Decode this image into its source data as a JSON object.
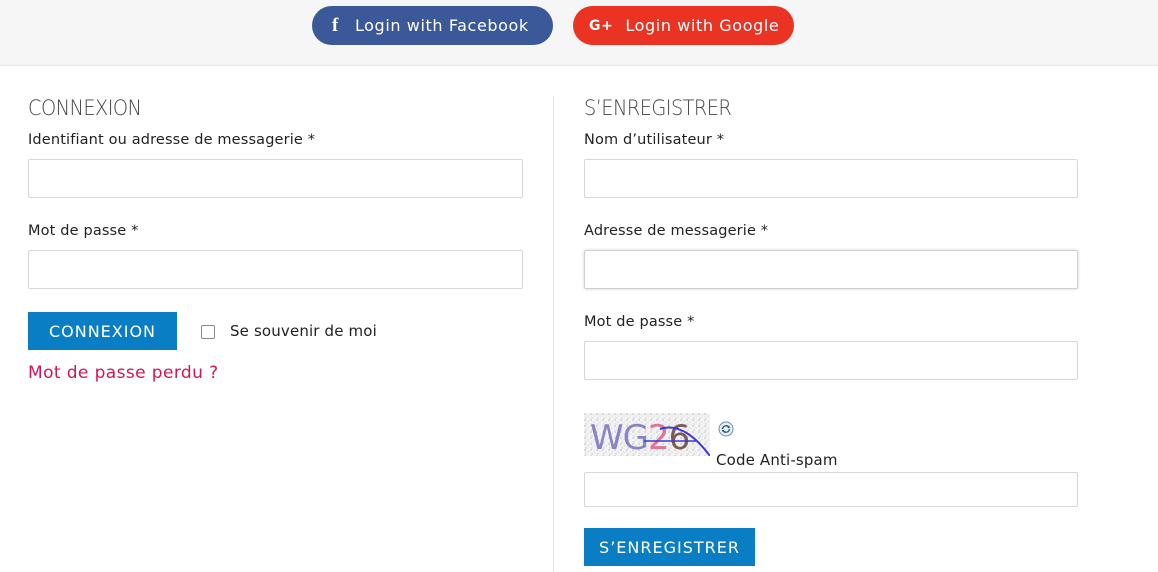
{
  "social": {
    "facebook_label": "Login with Facebook",
    "facebook_icon": "f",
    "google_label": "Login with Google",
    "google_icon": "G+"
  },
  "login": {
    "title": "CONNEXION",
    "username_label": "Identifiant ou adresse de messagerie *",
    "username_value": "",
    "password_label": "Mot de passe *",
    "password_value": "",
    "submit_label": "CONNEXION",
    "remember_label": "Se souvenir de moi",
    "remember_checked": false,
    "lost_password_label": "Mot de passe perdu ?"
  },
  "register": {
    "title": "S’ENREGISTRER",
    "username_label": "Nom d’utilisateur *",
    "username_value": "",
    "email_label": "Adresse de messagerie *",
    "email_value": "",
    "password_label": "Mot de passe *",
    "password_value": "",
    "captcha_text": "WG26",
    "captcha_label": "Code Anti-spam",
    "captcha_value": "",
    "submit_label": "S’ENREGISTRER"
  },
  "colors": {
    "facebook": "#3b5998",
    "google": "#ea3323",
    "primary": "#0a7ec4",
    "link": "#d4145a"
  }
}
